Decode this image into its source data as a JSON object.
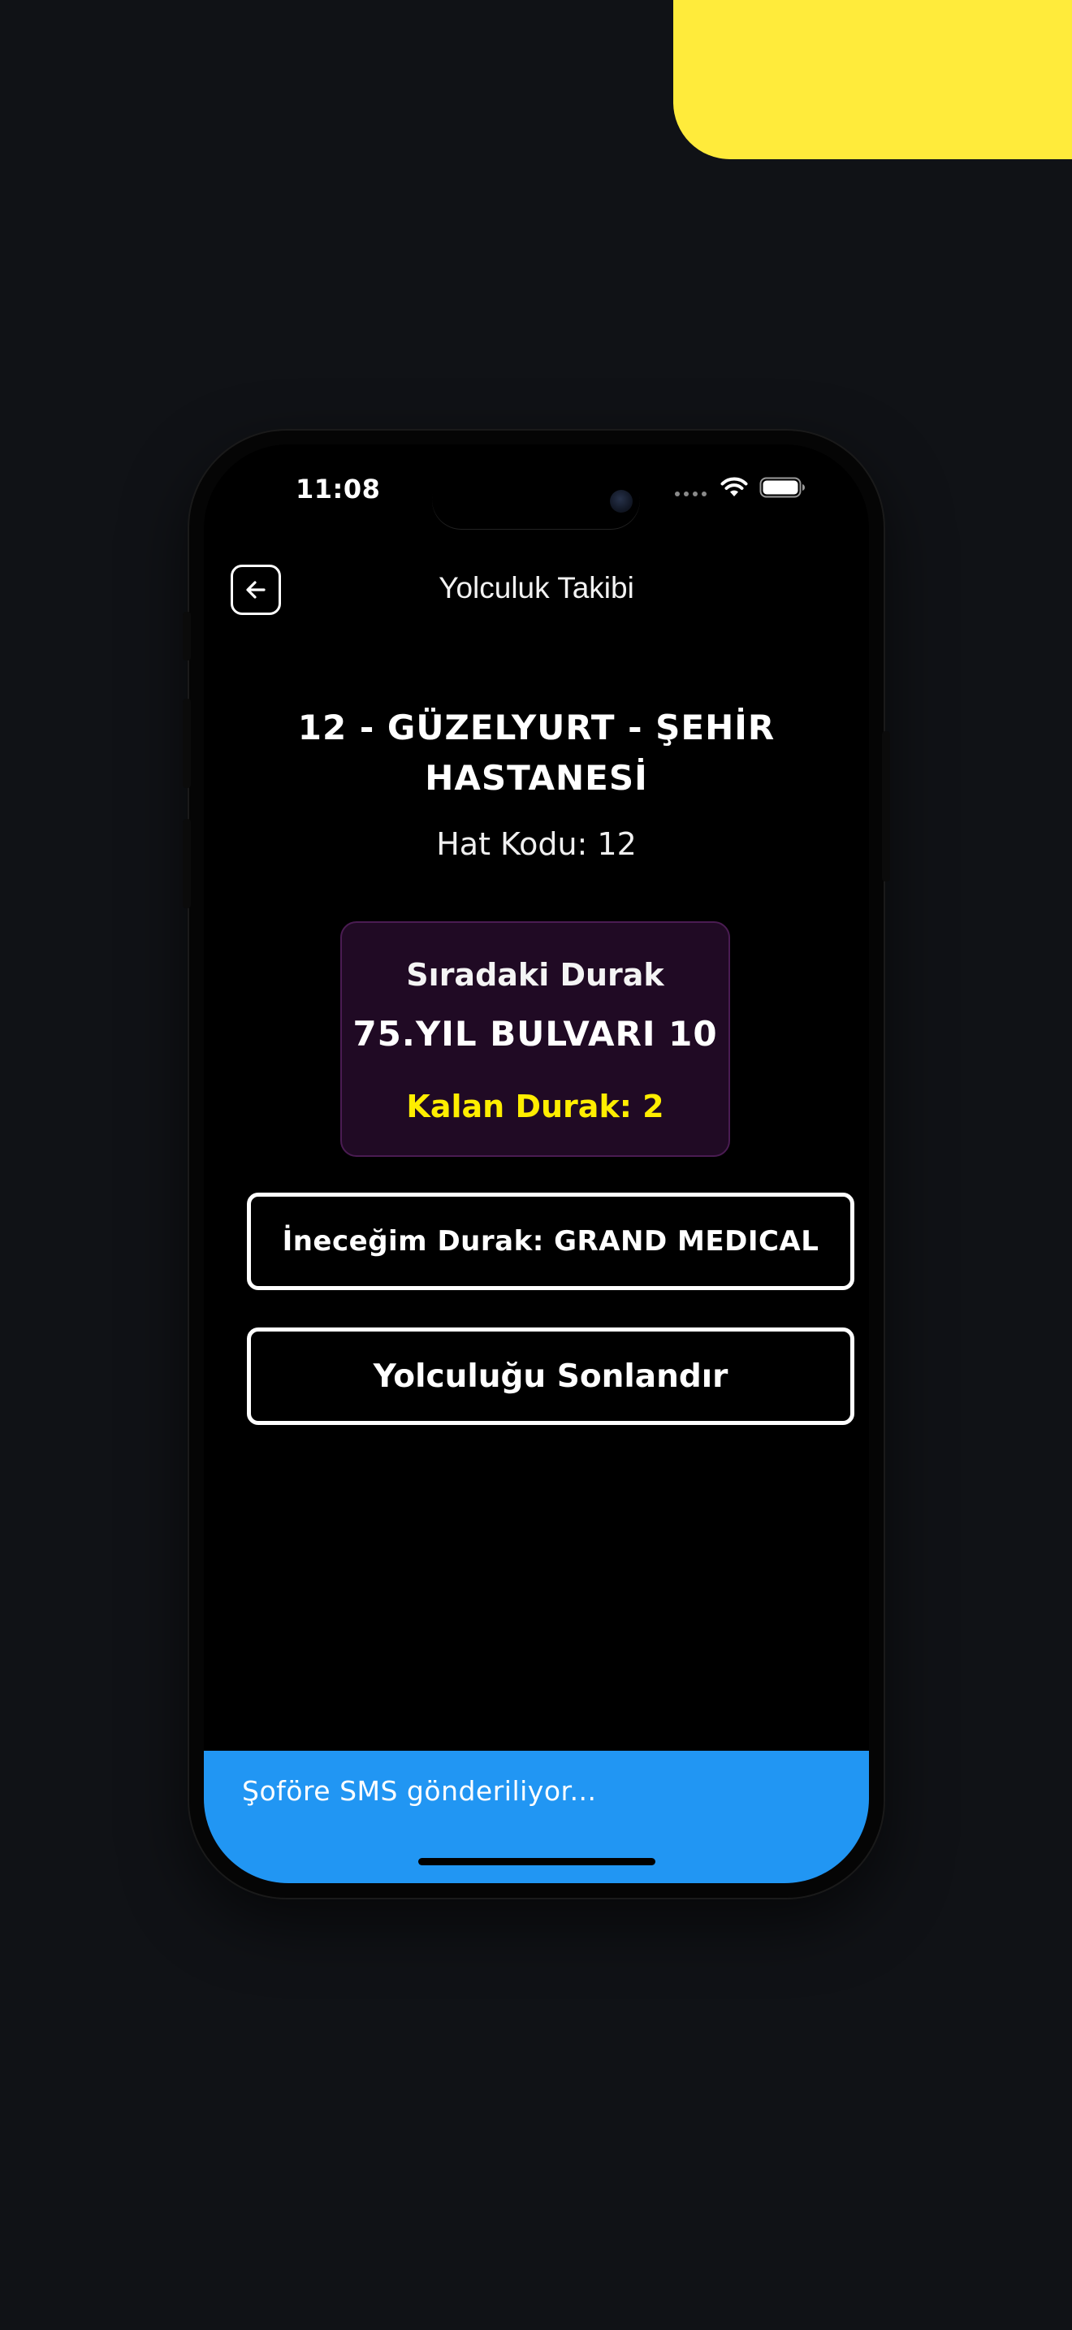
{
  "status_bar": {
    "time": "11:08",
    "wifi_icon": "wifi-icon",
    "battery_icon": "battery-full-icon"
  },
  "app_bar": {
    "title": "Yolculuk Takibi",
    "back_icon": "arrow-left-icon"
  },
  "route": {
    "title": "12 - GÜZELYURT - ŞEHİR HASTANESİ",
    "code_label": "Hat Kodu: 12"
  },
  "next_stop": {
    "label": "Sıradaki Durak",
    "name": "75.YIL BULVARI 10",
    "remaining": "Kalan Durak: 2"
  },
  "buttons": {
    "destination": "İneceğim Durak: GRAND MEDICAL",
    "end_trip": "Yolculuğu Sonlandır"
  },
  "snackbar": {
    "message": "Şoföre SMS gönderiliyor..."
  },
  "colors": {
    "background": "#101216",
    "accent_yellow": "#FFEB3B",
    "card_background": "#200A24",
    "remaining_text": "#FFEE00",
    "snackbar": "#2196F3"
  }
}
